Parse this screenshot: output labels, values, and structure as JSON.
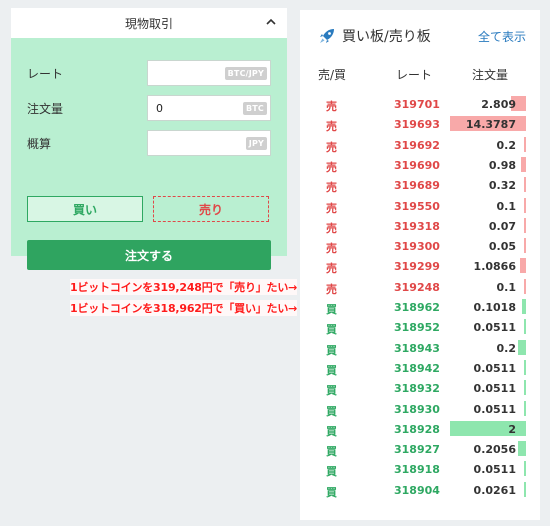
{
  "trade": {
    "title": "現物取引",
    "rate_label": "レート",
    "rate_unit": "BTC/JPY",
    "amount_label": "注文量",
    "amount_value": "0",
    "amount_unit": "BTC",
    "estimate_label": "概算",
    "estimate_unit": "JPY",
    "buy_label": "買い",
    "sell_label": "売り",
    "order_label": "注文する"
  },
  "book": {
    "title": "買い板/売り板",
    "show_all": "全て表示",
    "col_side": "売/買",
    "col_rate": "レート",
    "col_qty": "注文量",
    "asks": [
      {
        "side": "売",
        "rate": "319701",
        "qty": "2.809",
        "depth": 0.196
      },
      {
        "side": "売",
        "rate": "319693",
        "qty": "14.3787",
        "depth": 1.0
      },
      {
        "side": "売",
        "rate": "319692",
        "qty": "0.2",
        "depth": 0.014
      },
      {
        "side": "売",
        "rate": "319690",
        "qty": "0.98",
        "depth": 0.068
      },
      {
        "side": "売",
        "rate": "319689",
        "qty": "0.32",
        "depth": 0.022
      },
      {
        "side": "売",
        "rate": "319550",
        "qty": "0.1",
        "depth": 0.007
      },
      {
        "side": "売",
        "rate": "319318",
        "qty": "0.07",
        "depth": 0.005
      },
      {
        "side": "売",
        "rate": "319300",
        "qty": "0.05",
        "depth": 0.004
      },
      {
        "side": "売",
        "rate": "319299",
        "qty": "1.0866",
        "depth": 0.076
      },
      {
        "side": "売",
        "rate": "319248",
        "qty": "0.1",
        "depth": 0.007
      }
    ],
    "bids": [
      {
        "side": "買",
        "rate": "318962",
        "qty": "0.1018",
        "depth": 0.051
      },
      {
        "side": "買",
        "rate": "318952",
        "qty": "0.0511",
        "depth": 0.026
      },
      {
        "side": "買",
        "rate": "318943",
        "qty": "0.2",
        "depth": 0.1
      },
      {
        "side": "買",
        "rate": "318942",
        "qty": "0.0511",
        "depth": 0.026
      },
      {
        "side": "買",
        "rate": "318932",
        "qty": "0.0511",
        "depth": 0.026
      },
      {
        "side": "買",
        "rate": "318930",
        "qty": "0.0511",
        "depth": 0.026
      },
      {
        "side": "買",
        "rate": "318928",
        "qty": "2",
        "depth": 1.0
      },
      {
        "side": "買",
        "rate": "318927",
        "qty": "0.2056",
        "depth": 0.103
      },
      {
        "side": "買",
        "rate": "318918",
        "qty": "0.0511",
        "depth": 0.026
      },
      {
        "side": "買",
        "rate": "318904",
        "qty": "0.0261",
        "depth": 0.013
      }
    ]
  },
  "annotations": {
    "sell_note": "1ビットコインを319,248円で「売り」たい→",
    "buy_note": "1ビットコインを318,962円で「買い」たい→"
  },
  "colors": {
    "sell": "#e04848",
    "buy": "#2ea862",
    "panel_green": "#b9efd1",
    "order_button": "#2fa460",
    "link": "#2a7bbf"
  }
}
